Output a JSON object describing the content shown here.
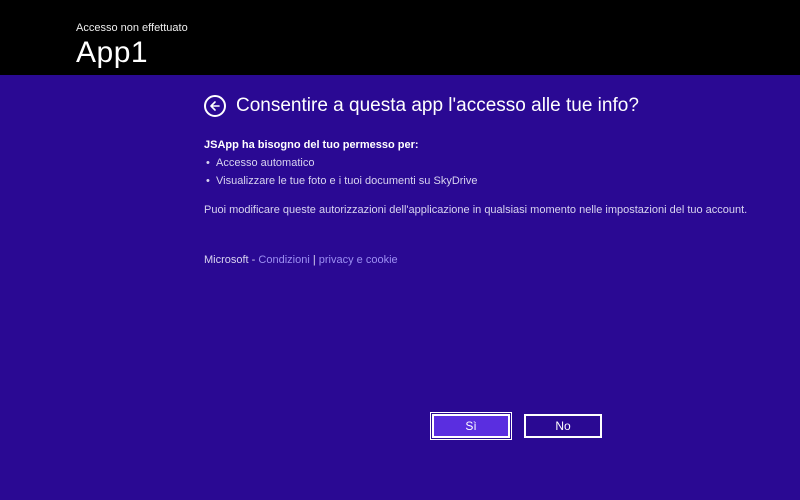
{
  "header": {
    "subtitle": "Accesso non effettuato",
    "title": "App1"
  },
  "dialog": {
    "title": "Consentire a questa app l'accesso alle tue info?",
    "permissions_lead": "JSApp ha bisogno del tuo permesso per:",
    "permissions": [
      "Accesso automatico",
      "Visualizzare le tue foto e i tuoi documenti su SkyDrive"
    ],
    "note": "Puoi modificare queste autorizzazioni dell'applicazione in qualsiasi momento nelle impostazioni del tuo account."
  },
  "footer": {
    "brand": "Microsoft",
    "dash": " - ",
    "terms": "Condizioni",
    "sep": " | ",
    "privacy": "privacy e cookie"
  },
  "buttons": {
    "yes": "Sì",
    "no": "No"
  }
}
